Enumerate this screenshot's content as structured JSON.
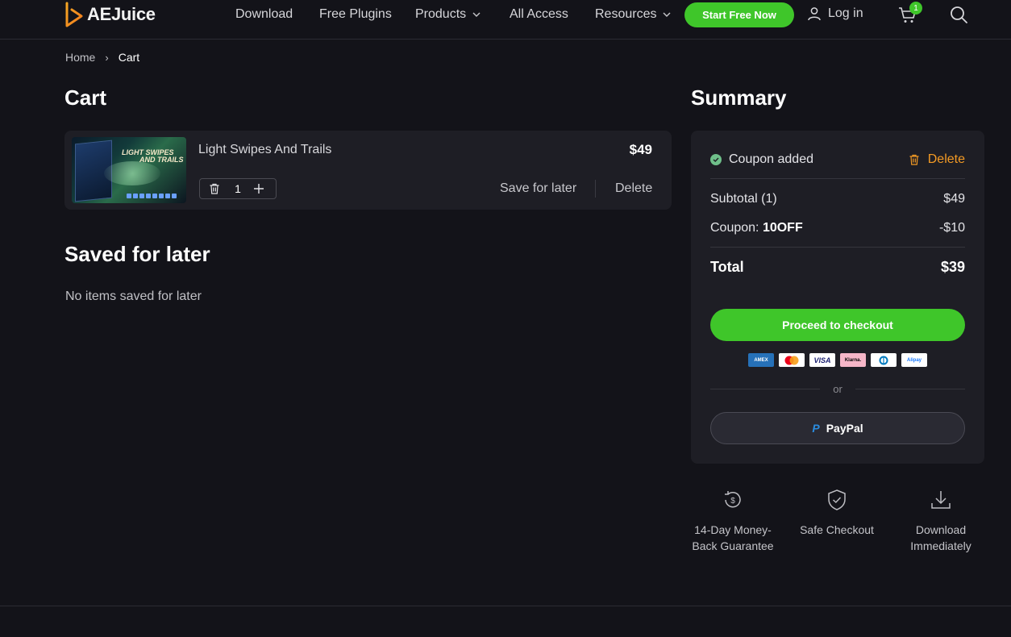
{
  "header": {
    "logo_text": "AEJuice",
    "nav": [
      {
        "label": "Download"
      },
      {
        "label": "Free Plugins"
      },
      {
        "label": "Products"
      },
      {
        "label": "All Access"
      },
      {
        "label": "Resources"
      }
    ],
    "cta_label": "Start Free Now",
    "login_label": "Log in",
    "cart_count": "1"
  },
  "breadcrumb": {
    "home": "Home",
    "separator": "›",
    "current": "Cart"
  },
  "cart": {
    "title": "Cart",
    "items": [
      {
        "name": "Light Swipes And Trails",
        "price": "$49",
        "quantity": "1",
        "thumb_line1": "LIGHT SWIPES",
        "thumb_line2": "AND TRAILS",
        "save_label": "Save for later",
        "delete_label": "Delete"
      }
    ]
  },
  "saved": {
    "title": "Saved for later",
    "empty_text": "No items saved for later"
  },
  "summary": {
    "title": "Summary",
    "coupon_added": "Coupon added",
    "coupon_delete": "Delete",
    "subtotal_label": "Subtotal (1)",
    "subtotal_value": "$49",
    "coupon_label": "Coupon: ",
    "coupon_code": "10OFF",
    "coupon_value": "-$10",
    "total_label": "Total",
    "total_value": "$39",
    "checkout_label": "Proceed to checkout",
    "payment_icons": [
      "AMEX",
      "mastercard",
      "VISA",
      "Klarna.",
      "diners",
      "Alipay"
    ],
    "or_label": "or",
    "paypal_label": "PayPal"
  },
  "features": [
    {
      "line1": "14-Day Money-",
      "line2": "Back Guarantee",
      "icon": "money-back-icon"
    },
    {
      "line1": "Safe Checkout",
      "line2": "",
      "icon": "shield-check-icon"
    },
    {
      "line1": "Download",
      "line2": "Immediately",
      "icon": "download-icon"
    }
  ],
  "colors": {
    "accent_green": "#3fc62a",
    "delete_orange": "#f39a24",
    "background": "#131319",
    "card": "#1e1e25"
  }
}
